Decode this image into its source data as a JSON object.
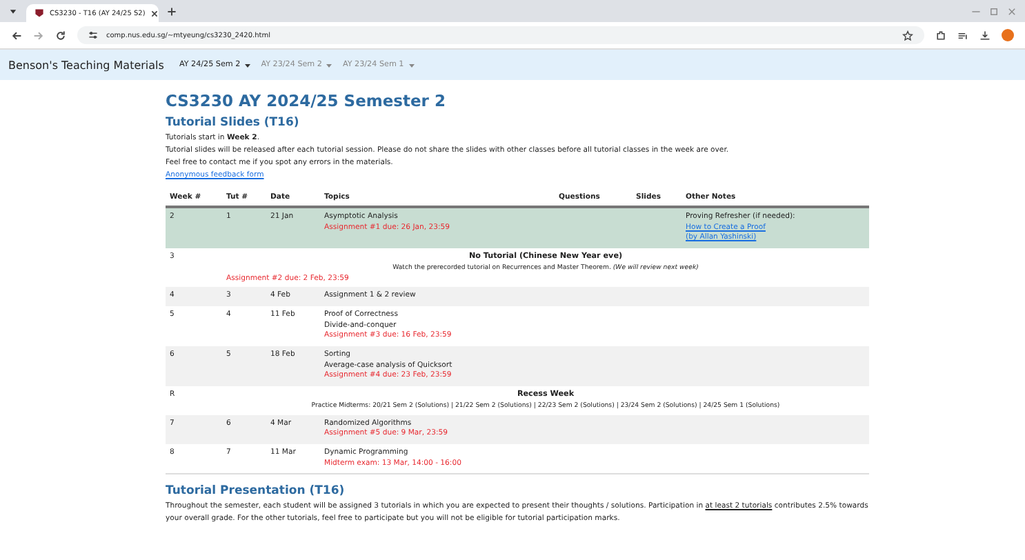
{
  "browser": {
    "tabs": [
      {
        "title": "CS3230 - T16 (AY 24/25 S2)",
        "selected": true
      }
    ],
    "url": "comp.nus.edu.sg/~mtyeung/cs3230_2420.html"
  },
  "navbar": {
    "brand": "Benson's Teaching Materials",
    "menus": [
      {
        "label": "AY 24/25 Sem 2",
        "selected": true
      },
      {
        "label": "AY 23/24 Sem 2",
        "selected": false
      },
      {
        "label": "AY 23/24 Sem 1",
        "selected": false
      }
    ]
  },
  "page": {
    "title": "CS3230 AY 2024/25 Semester 2",
    "section": "Tutorial Slides (T16)",
    "intro": [
      "Tutorials start in **Week 2**.",
      "Tutorial slides will be released after each tutorial session. Please do not share the slides with other classes before all tutorial classes in the week are over.",
      "Feel free to contact me if you spot any errors in the materials."
    ],
    "feedback_link": "Anonymous feedback form",
    "table": {
      "columns": [
        "Week #",
        "Tut #",
        "Date",
        "Topics",
        "Questions",
        "Slides",
        "Other Notes"
      ],
      "rows": [
        {
          "kind": "tutorial",
          "highlighted": true,
          "week": "2",
          "tut": "1",
          "date": "21 Jan",
          "topics": [
            {
              "kind": "text",
              "text": "Asymptotic Analysis"
            },
            {
              "kind": "due",
              "text": "Assignment #1 due: 26 Jan, 23:59"
            }
          ],
          "notes": [
            {
              "kind": "text",
              "text": "Proving Refresher (if needed):"
            },
            {
              "kind": "link",
              "text": "How to Create a Proof"
            },
            {
              "kind": "link",
              "text": "(by Allan Yashinski)"
            }
          ]
        },
        {
          "kind": "break",
          "week": "3",
          "title": "No Tutorial (Chinese New Year eve)",
          "note": "Watch the prerecorded tutorial on Recurrences and Master Theorem. *(We will review next week)*",
          "due": "Assignment #2 due: 2 Feb, 23:59"
        },
        {
          "kind": "tutorial",
          "highlighted": false,
          "week": "4",
          "tut": "3",
          "date": "4 Feb",
          "topics": [
            {
              "kind": "text",
              "text": "Assignment 1 & 2 review"
            }
          ],
          "notes": []
        },
        {
          "kind": "tutorial",
          "highlighted": false,
          "week": "5",
          "tut": "4",
          "date": "11 Feb",
          "topics": [
            {
              "kind": "text",
              "text": "Proof of Correctness"
            },
            {
              "kind": "text",
              "text": "Divide-and-conquer"
            },
            {
              "kind": "due",
              "text": "Assignment #3 due: 16 Feb, 23:59"
            }
          ],
          "notes": []
        },
        {
          "kind": "tutorial",
          "highlighted": false,
          "week": "6",
          "tut": "5",
          "date": "18 Feb",
          "topics": [
            {
              "kind": "text",
              "text": "Sorting"
            },
            {
              "kind": "text",
              "text": "Average-case analysis of Quicksort"
            },
            {
              "kind": "due",
              "text": "Assignment #4 due: 23 Feb, 23:59"
            }
          ],
          "notes": []
        },
        {
          "kind": "break",
          "week": "R",
          "title": "Recess Week",
          "note": "Practice Midterms: 20/21 Sem 2 (Solutions) | 21/22 Sem 2 (Solutions) | 22/23 Sem 2 (Solutions) | 23/24 Sem 2 (Solutions) | 24/25 Sem 1 (Solutions)"
        },
        {
          "kind": "tutorial",
          "highlighted": false,
          "week": "7",
          "tut": "6",
          "date": "4 Mar",
          "topics": [
            {
              "kind": "text",
              "text": "Randomized Algorithms"
            },
            {
              "kind": "due",
              "text": "Assignment #5 due: 9 Mar, 23:59"
            }
          ],
          "notes": []
        },
        {
          "kind": "tutorial",
          "highlighted": false,
          "week": "8",
          "tut": "7",
          "date": "11 Mar",
          "topics": [
            {
              "kind": "text",
              "text": "Dynamic Programming"
            },
            {
              "kind": "due",
              "text": "Midterm exam: 13 Mar, 14:00 - 16:00"
            }
          ],
          "notes": []
        }
      ]
    },
    "section2": "Tutorial Presentation (T16)",
    "paragraph": {
      "before": "Throughout the semester, each student will be assigned 3 tutorials in which you are expected to present their thoughts / solutions. Participation in ",
      "underlined": "at least 2 tutorials",
      "after": " contributes 2.5% towards your overall grade. For the other tutorials, feel free to participate but you will not be eligible for tutorial participation marks."
    }
  }
}
